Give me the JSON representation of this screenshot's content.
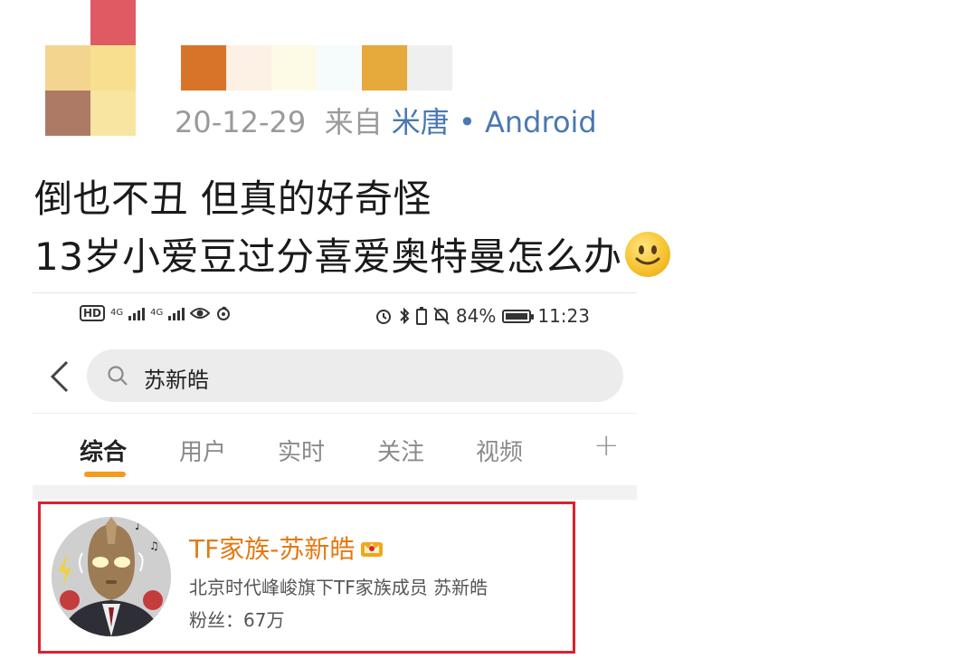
{
  "post": {
    "date": "20-12-29",
    "from_label": "来自",
    "source_link": "米唐 • Android",
    "line1": "倒也不丑 但真的好奇怪",
    "line2": "13岁小爱豆过分喜爱奥特曼怎么办",
    "emoji": "smile-emoji"
  },
  "colors": {
    "link": "#4a78b0",
    "accent": "#f39b1e",
    "name_orange": "#e27a12",
    "highlight_border": "#d9232e"
  },
  "screenshot": {
    "status_bar": {
      "hd": "HD",
      "net1": "4G",
      "net2": "4G",
      "battery_percent": "84%",
      "time": "11:23",
      "battery_level": 0.84
    },
    "search": {
      "query": "苏新皓"
    },
    "tabs": [
      {
        "label": "综合",
        "active": true
      },
      {
        "label": "用户",
        "active": false
      },
      {
        "label": "实时",
        "active": false
      },
      {
        "label": "关注",
        "active": false
      },
      {
        "label": "视频",
        "active": false
      }
    ],
    "tabs_more": "+",
    "result": {
      "name": "TF家族-苏新皓",
      "description": "北京时代峰峻旗下TF家族成员 苏新皓",
      "fans": "粉丝：67万"
    }
  }
}
